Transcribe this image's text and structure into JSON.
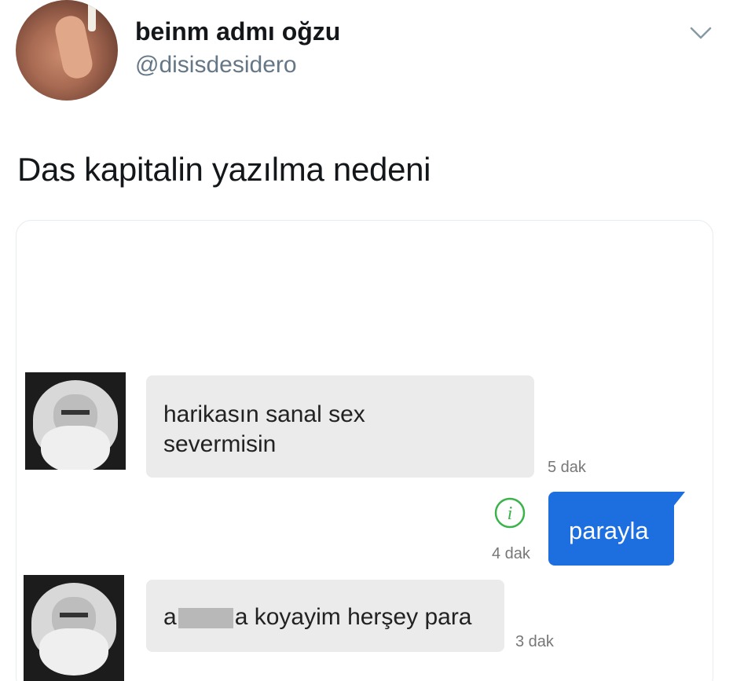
{
  "tweet": {
    "display_name": "beinm admı oğzu",
    "handle": "@disisdesidero",
    "text": "Das kapitalin yazılma nedeni"
  },
  "chat": {
    "messages": [
      {
        "direction": "incoming",
        "text": "harikasın sanal sex severmisin",
        "line1": "harikasın sanal sex",
        "line2": "severmisin",
        "time": "5 dak"
      },
      {
        "direction": "outgoing",
        "text": "parayla",
        "time": "4 dak"
      },
      {
        "direction": "incoming",
        "prefix": "a",
        "suffix": "a koyayim herşey para",
        "time": "3 dak"
      }
    ]
  },
  "icons": {
    "menu": "chevron-down-icon",
    "info": "info-icon"
  },
  "colors": {
    "outgoing_bubble": "#1d6fe0",
    "incoming_bubble": "#ebebeb",
    "info_icon": "#3bb34a"
  }
}
